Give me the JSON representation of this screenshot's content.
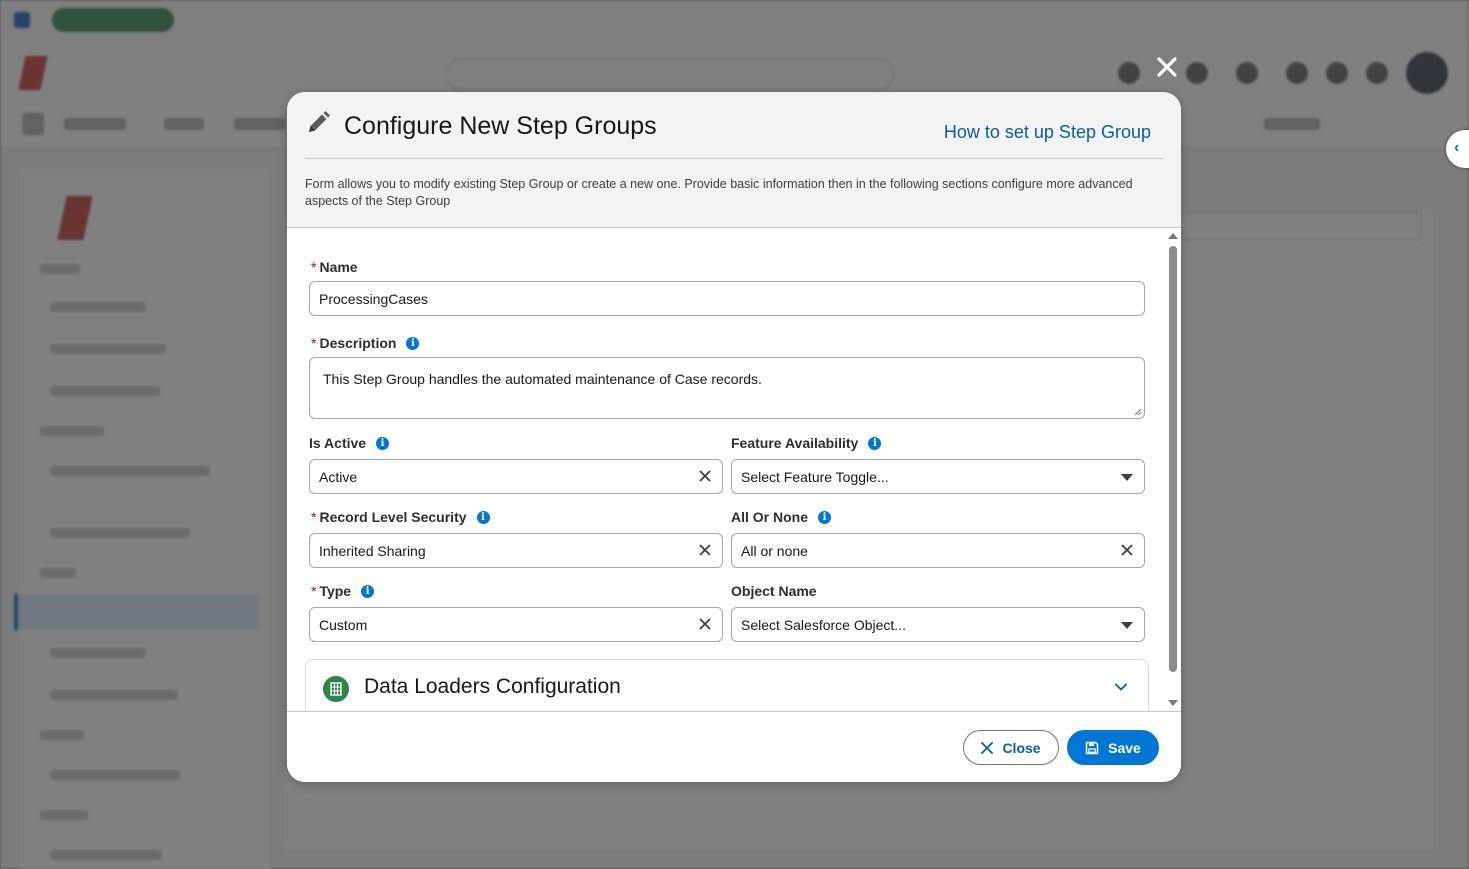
{
  "modal": {
    "title": "Configure New Step Groups",
    "help_link": "How to set up Step Group",
    "description": "Form allows you to modify existing Step Group or create a new one. Provide basic information then in the following sections configure more advanced aspects of the Step Group",
    "close_icon": "close-icon"
  },
  "form": {
    "name": {
      "label": "Name",
      "value": "ProcessingCases",
      "required": true
    },
    "description": {
      "label": "Description",
      "value": "This Step Group handles the automated maintenance of Case records.",
      "required": true
    },
    "is_active": {
      "label": "Is Active",
      "value": "Active"
    },
    "feature_availability": {
      "label": "Feature Availability",
      "placeholder": "Select Feature Toggle..."
    },
    "record_level_security": {
      "label": "Record Level Security",
      "value": "Inherited Sharing",
      "required": true
    },
    "all_or_none": {
      "label": "All Or None",
      "value": "All or none"
    },
    "type": {
      "label": "Type",
      "value": "Custom",
      "required": true
    },
    "object_name": {
      "label": "Object Name",
      "placeholder": "Select Salesforce Object..."
    }
  },
  "sections": {
    "data_loaders": {
      "title": "Data Loaders Configuration",
      "icon": "table-icon"
    }
  },
  "footer": {
    "close_label": "Close",
    "save_label": "Save"
  },
  "colors": {
    "brand_blue": "#0176d3",
    "link_blue": "#0b5cab",
    "required_red": "#ba0517",
    "section_green": "#2e844a"
  }
}
